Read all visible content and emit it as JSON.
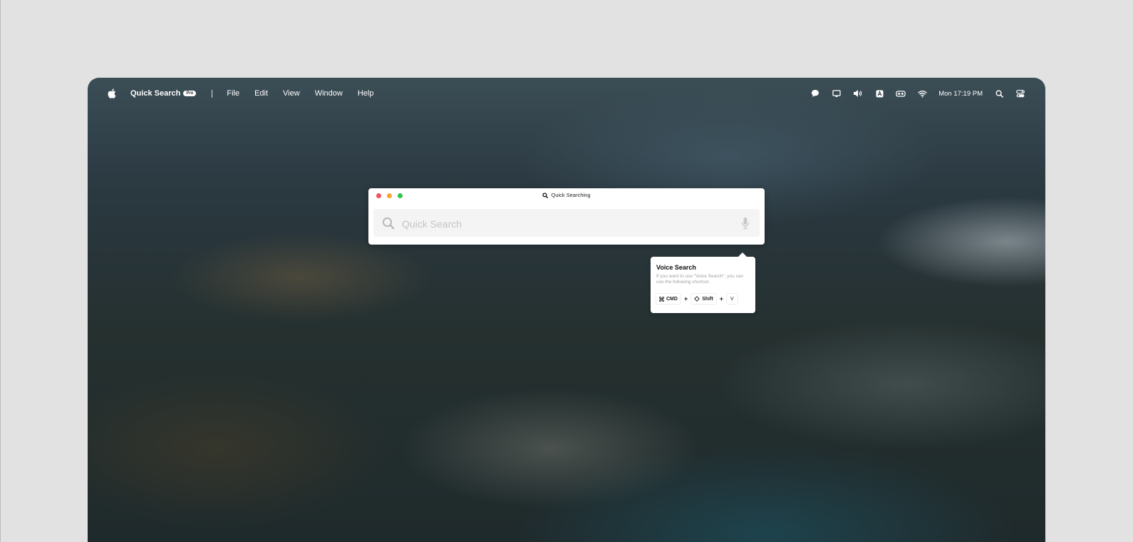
{
  "menubar": {
    "apple_icon": "apple-icon",
    "app_name": "Quick Search",
    "badge": "Pro",
    "separator": "|",
    "menus": [
      "File",
      "Edit",
      "View",
      "Window",
      "Help"
    ],
    "status_icons": [
      "chat-bubble-icon",
      "screen-mirroring-icon",
      "volume-icon",
      "keyboard-input-icon",
      "vr-headset-icon",
      "wifi-icon"
    ],
    "clock": "Mon 17:19 PM",
    "search_icon": "spotlight-search-icon",
    "control_center_icon": "control-center-icon"
  },
  "window": {
    "title": "Quick Searching",
    "title_icon": "search-icon",
    "traffic_lights": {
      "close": "#f5515f",
      "minimize": "#f7a531",
      "maximize": "#32c24d"
    },
    "search": {
      "placeholder": "Quick Search",
      "value": "",
      "icon": "search-icon",
      "mic_icon": "microphone-icon"
    }
  },
  "popover": {
    "title": "Voice Search",
    "description": "If you want to use \"Voice Search\", you can use the following shortcut.",
    "shortcut": {
      "keys": [
        {
          "icon": "command-icon",
          "label": "CMD"
        },
        {
          "icon": "shift-icon",
          "label": "Shift"
        },
        {
          "label": "V"
        }
      ],
      "joiner": "+"
    }
  },
  "colors": {
    "page_background": "#e2e2e2",
    "window_background": "#ffffff",
    "search_field_background": "#f4f4f4",
    "placeholder_text": "#c4c4c4"
  }
}
